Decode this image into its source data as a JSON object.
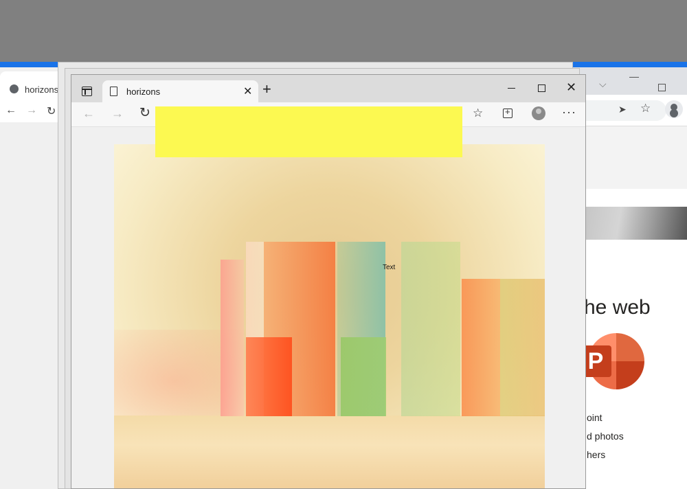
{
  "back_left_window": {
    "tab_title": "horizons"
  },
  "back_right_window": {
    "heading": "he web",
    "app_logo_letter": "P",
    "list_items": [
      "oint",
      "d photos",
      "hers"
    ]
  },
  "main_window": {
    "tab_title": "horizons",
    "artwork": {
      "label": "Text"
    }
  },
  "colors": {
    "accent_blue": "#1a73e8",
    "redaction_yellow": "#fcf951",
    "powerpoint_orange": "#c43e1c"
  },
  "icons": [
    "tab-actions-icon",
    "page-icon",
    "close-icon",
    "plus-icon",
    "back-arrow-icon",
    "forward-arrow-icon",
    "reload-icon",
    "favorites-icon",
    "collections-icon",
    "profile-icon",
    "more-icon",
    "globe-icon",
    "send-icon",
    "star-icon"
  ]
}
